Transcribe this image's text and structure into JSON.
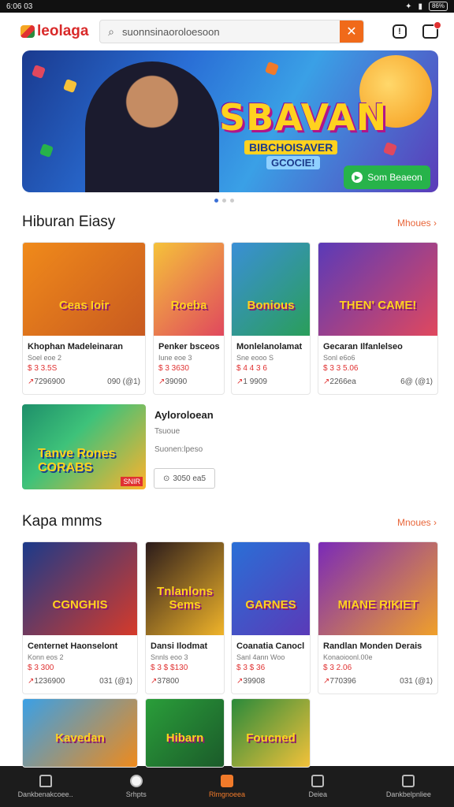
{
  "statusbar": {
    "time": "6:06 03",
    "battery": "86%"
  },
  "topbar": {
    "brand": "leolaga",
    "search_value": "suonnsinaoroloesoon",
    "clear_label": "✕"
  },
  "banner": {
    "headline": "SBAVAN",
    "sub1": "BIBCHOISAVER",
    "sub2": "GCOCIE!",
    "cta": "Som Beaeon",
    "colors": {
      "bg_start": "#1a3a8f",
      "accent": "#ffd21f",
      "cta": "#27b34a"
    }
  },
  "section1": {
    "title": "Hiburan Eiasy",
    "more": "Mhoues ›",
    "cards": [
      {
        "thumb_text": "Ceas Ioir",
        "name": "Khophan Madeleinaran",
        "meta": "Soel eoe 2",
        "price": "$ 3 3.5S",
        "sold": "7296900",
        "rating": "090 (@1)",
        "colors": [
          "#f08a1a",
          "#c85a20"
        ]
      },
      {
        "thumb_text": "Roeba",
        "name": "Penker bsceos",
        "meta": "Iune eoe 3",
        "price": "$ 3 3630",
        "sold": "39090",
        "rating": "",
        "colors": [
          "#f5c23a",
          "#e0485e"
        ]
      },
      {
        "thumb_text": "Bonious",
        "name": "Monlelanolamat",
        "meta": "Sne eooo S",
        "price": "$ 4 4 3 6",
        "sold": "1 9909",
        "rating": "",
        "colors": [
          "#3a8fd6",
          "#2a9e5a"
        ]
      },
      {
        "thumb_text": "THEN' CAME!",
        "name": "Gecaran Ilfanlelseo",
        "meta": "Sonl e6o6",
        "price": "$ 3 3 5.06",
        "sold": "2266ea",
        "rating": "6@ (@1)",
        "colors": [
          "#5a3ab8",
          "#e0485e"
        ]
      }
    ]
  },
  "featured": {
    "thumb_text": "Tanve Rones CORABS",
    "badge": "SNIR",
    "title": "Ayloroloean",
    "subtitle": "Tsuoue",
    "subtitle2": "Suonen:lpeso",
    "button": "3050 ea5"
  },
  "section2": {
    "title": "Kapa mnms",
    "more": "Mnoues ›",
    "cards": [
      {
        "thumb_text": "CGNGHIS",
        "name": "Centernet Haonselont",
        "meta": "Konn eos 2",
        "price": "$ 3 300",
        "sold": "1236900",
        "rating": "031 (@1)",
        "colors": [
          "#1b3a8a",
          "#d63a2a"
        ]
      },
      {
        "thumb_text": "Tnlanlons Sems",
        "name": "Dansi Ilodmat",
        "meta": "Snnls eoo 3",
        "price": "$ 3 $ $130",
        "sold": "37800",
        "rating": "",
        "colors": [
          "#2b1b1b",
          "#f0b42a"
        ]
      },
      {
        "thumb_text": "GARNES",
        "name": "Coanatia Canocl",
        "meta": "Sanl 4ann Woo",
        "price": "$ 3 $ 36",
        "sold": "39908",
        "rating": "",
        "colors": [
          "#2a6fd6",
          "#5a3ab8"
        ]
      },
      {
        "thumb_text": "MIANE RIKIET",
        "name": "Randlan Monden Derais",
        "meta": "Konaoioonl.00e",
        "price": "$ 3 2.06",
        "sold": "770396",
        "rating": "031 (@1)",
        "colors": [
          "#7a2ab8",
          "#f0a02a"
        ]
      }
    ]
  },
  "section3": {
    "cards": [
      {
        "thumb_text": "Kavedan",
        "colors": [
          "#3aa0e6",
          "#f08a1a"
        ]
      },
      {
        "thumb_text": "Hibarn",
        "colors": [
          "#2a9e3a",
          "#1b5a2a"
        ]
      },
      {
        "thumb_text": "Foucned",
        "colors": [
          "#2a8a3a",
          "#f5c23a"
        ]
      }
    ]
  },
  "navbar": {
    "items": [
      {
        "label": "Dankbenakcoee..",
        "icon": "home-icon"
      },
      {
        "label": "Srhpts",
        "icon": "search-icon"
      },
      {
        "label": "Rlmgnoeea",
        "icon": "categories-icon",
        "active": true
      },
      {
        "label": "Deiea",
        "icon": "messages-icon"
      },
      {
        "label": "Dankbelpnliee",
        "icon": "profile-icon"
      }
    ]
  }
}
